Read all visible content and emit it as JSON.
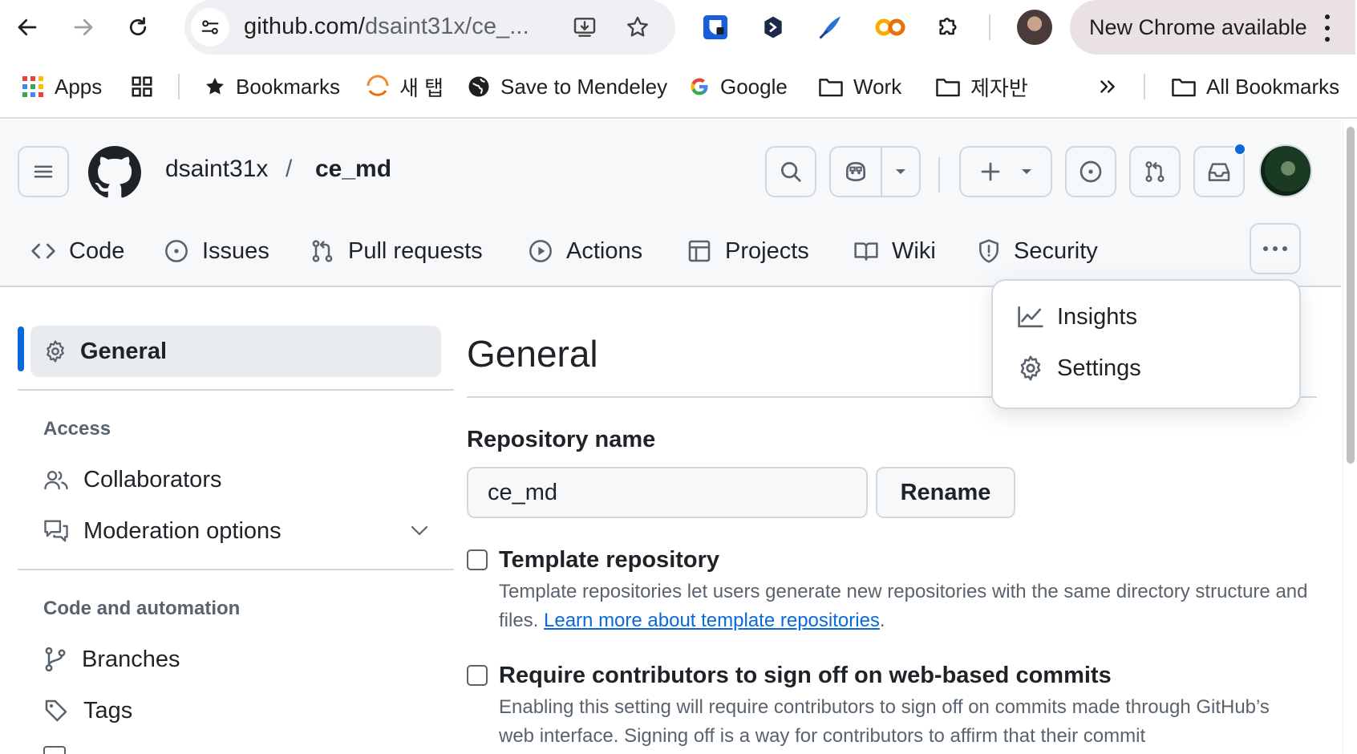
{
  "browser": {
    "url_host": "github.com/",
    "url_rest": "dsaint31x/ce_...",
    "new_chrome_label": "New Chrome available",
    "icons": [
      "back-icon",
      "forward-icon",
      "reload-icon",
      "site-info-icon",
      "install-app-icon",
      "bookmark-star-icon",
      "bitwarden-icon",
      "extension-icon",
      "zotero-icon",
      "colab-icon",
      "extensions-puzzle-icon",
      "menu-icon"
    ]
  },
  "bookmarks": {
    "apps": "Apps",
    "bookmarks": "Bookmarks",
    "new_tab": "새 탭",
    "mendeley": "Save to Mendeley",
    "google": "Google",
    "work": "Work",
    "folder_kr": "제자반",
    "all_bookmarks": "All Bookmarks"
  },
  "repo": {
    "owner": "dsaint31x",
    "slash": "/",
    "name": "ce_md"
  },
  "tabs": [
    {
      "label": "Code"
    },
    {
      "label": "Issues"
    },
    {
      "label": "Pull requests"
    },
    {
      "label": "Actions"
    },
    {
      "label": "Projects"
    },
    {
      "label": "Wiki"
    },
    {
      "label": "Security"
    }
  ],
  "dropdown": {
    "insights": "Insights",
    "settings": "Settings"
  },
  "sidebar": {
    "general": "General",
    "access_heading": "Access",
    "collaborators": "Collaborators",
    "moderation": "Moderation options",
    "code_heading": "Code and automation",
    "branches": "Branches",
    "tags": "Tags"
  },
  "main": {
    "title": "General",
    "repo_name_label": "Repository name",
    "repo_name_value": "ce_md",
    "rename_label": "Rename",
    "template": {
      "title": "Template repository",
      "desc": "Template repositories let users generate new repositories with the same directory structure and files. ",
      "link": "Learn more about template repositories",
      "end": "."
    },
    "signoff": {
      "title": "Require contributors to sign off on web-based commits",
      "desc": "Enabling this setting will require contributors to sign off on commits made through GitHub’s web interface. Signing off is a way for contributors to affirm that their commit"
    }
  },
  "colors": {
    "accent": "#0969da",
    "header_bg": "#f6f8fa",
    "border": "#d1d9e0",
    "muted_text": "#59636e"
  }
}
